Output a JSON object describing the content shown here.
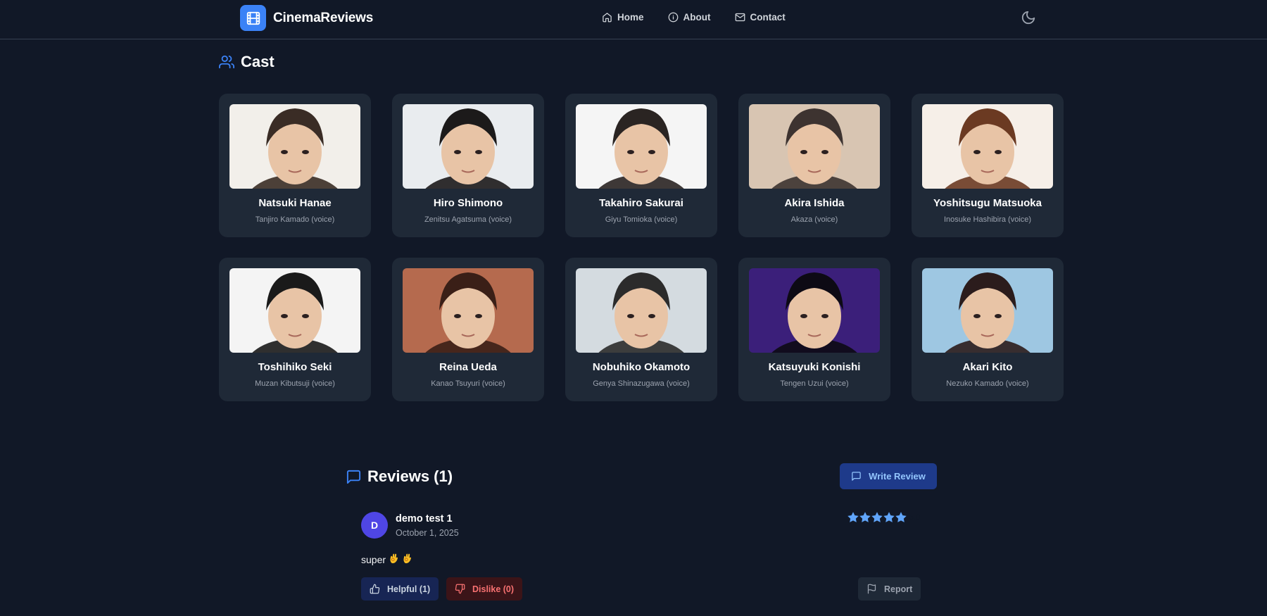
{
  "nav": {
    "brand": "CinemaReviews",
    "links": [
      {
        "label": "Home",
        "icon": "home-icon"
      },
      {
        "label": "About",
        "icon": "info-icon"
      },
      {
        "label": "Contact",
        "icon": "mail-icon"
      }
    ],
    "theme_icon": "moon-icon"
  },
  "cast": {
    "title": "Cast",
    "members": [
      {
        "name": "Natsuki Hanae",
        "role": "Tanjiro Kamado (voice)",
        "photo_colors": [
          "#f2efea",
          "#3a2c25"
        ]
      },
      {
        "name": "Hiro Shimono",
        "role": "Zenitsu Agatsuma (voice)",
        "photo_colors": [
          "#e9ecef",
          "#1c1a1a"
        ]
      },
      {
        "name": "Takahiro Sakurai",
        "role": "Giyu Tomioka (voice)",
        "photo_colors": [
          "#f5f5f5",
          "#2a2422"
        ]
      },
      {
        "name": "Akira Ishida",
        "role": "Akaza (voice)",
        "photo_colors": [
          "#d8c5b2",
          "#3d3330"
        ]
      },
      {
        "name": "Yoshitsugu Matsuoka",
        "role": "Inosuke Hashibira (voice)",
        "photo_colors": [
          "#f6efe8",
          "#6b3a22"
        ]
      },
      {
        "name": "Toshihiko Seki",
        "role": "Muzan Kibutsuji (voice)",
        "photo_colors": [
          "#f4f4f4",
          "#1a1a1a"
        ]
      },
      {
        "name": "Reina Ueda",
        "role": "Kanao Tsuyuri (voice)",
        "photo_colors": [
          "#b56a4e",
          "#3a1f17"
        ]
      },
      {
        "name": "Nobuhiko Okamoto",
        "role": "Genya Shinazugawa (voice)",
        "photo_colors": [
          "#d4dbe0",
          "#2b2b2b"
        ]
      },
      {
        "name": "Katsuyuki Konishi",
        "role": "Tengen Uzui (voice)",
        "photo_colors": [
          "#3b1f7a",
          "#0d0a14"
        ]
      },
      {
        "name": "Akari Kito",
        "role": "Nezuko Kamado (voice)",
        "photo_colors": [
          "#9ec7e2",
          "#2b1c1c"
        ]
      }
    ]
  },
  "reviews": {
    "title": "Reviews (1)",
    "write_button": "Write Review",
    "items": [
      {
        "avatar_letter": "D",
        "author": "demo test 1",
        "date": "October 1, 2025",
        "rating": 5.0,
        "rating_label": "5.0",
        "text": "super",
        "emoji_count": 2,
        "helpful_label": "Helpful (1)",
        "dislike_label": "Dislike (0)",
        "report_label": "Report"
      }
    ]
  },
  "colors": {
    "background": "#111827",
    "card": "#1f2937",
    "accent": "#3b82f6",
    "star": "#60a5fa",
    "danger": "#f87171"
  }
}
